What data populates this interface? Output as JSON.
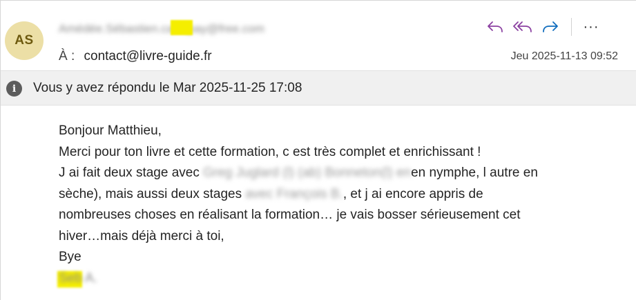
{
  "header": {
    "avatar_initials": "AS",
    "sender_redacted": "Amédée.Sébastien.carrupay@free.com",
    "recipient_label": "À :",
    "recipient_value": "contact@livre-guide.fr",
    "date": "Jeu 2025-11-13 09:52",
    "actions": {
      "reply_icon": "reply-icon",
      "reply_all_icon": "reply-all-icon",
      "forward_icon": "forward-icon",
      "more_label": "···"
    },
    "colors": {
      "avatar_bg": "#ecdfa6",
      "reply_purple": "#8a3fa0",
      "forward_blue": "#0f6cbd"
    }
  },
  "banner": {
    "icon": "info-icon",
    "text": "Vous y avez répondu le Mar 2025-11-25 17:08"
  },
  "message": {
    "greeting": "Bonjour Matthieu,",
    "line1": "Merci pour ton livre et cette formation, c est très complet et enrichissant !",
    "line2_a": "J ai fait deux stage avec",
    "line2_redacted": "Greg Juglard (l) (ab) Bonneton(l) en",
    "line2_b": "en nymphe, l autre en",
    "line3_a": "sèche), mais aussi deux stages",
    "line3_redacted": "avec François B.",
    "line3_b": ", et j ai encore appris de",
    "line4": "nombreuses choses en réalisant la formation… je vais bosser sérieusement cet",
    "line5": "hiver…mais déjà merci à toi,",
    "closing": "Bye",
    "signature_redacted": "Seb A."
  }
}
